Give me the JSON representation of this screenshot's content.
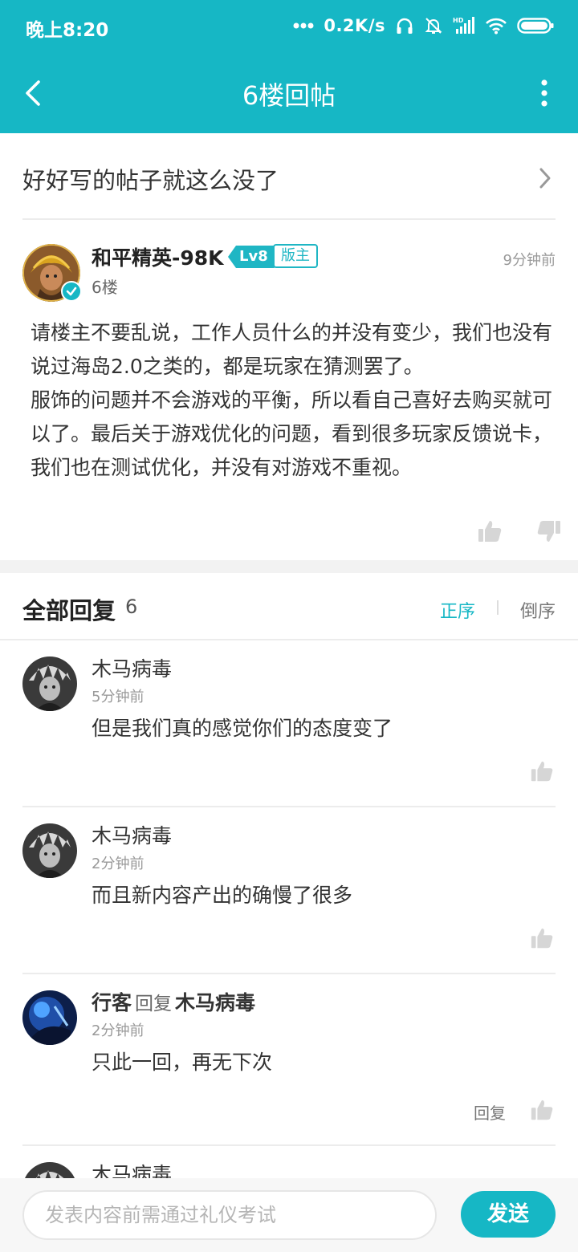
{
  "status_bar": {
    "time": "晚上8:20",
    "network_speed": "0.2K/s"
  },
  "nav": {
    "title": "6楼回帖",
    "icons": [
      "back-arrow-icon",
      "more-vertical-icon"
    ]
  },
  "thread_link": {
    "title": "好好写的帖子就这么没了"
  },
  "floor_post": {
    "author": "和平精英-98K",
    "level": "Lv8",
    "role_badge": "版主",
    "time": "9分钟前",
    "floor": "6楼",
    "content": "请楼主不要乱说，工作人员什么的并没有变少，我们也没有说过海岛2.0之类的，都是玩家在猜测罢了。\n服饰的问题并不会游戏的平衡，所以看自己喜好去购买就可以了。最后关于游戏优化的问题，看到很多玩家反馈说卡，我们也在测试优化，并没有对游戏不重视。"
  },
  "replies_header": {
    "title": "全部回复",
    "count": "6",
    "sort_asc": "正序",
    "sort_desc": "倒序"
  },
  "replies": [
    {
      "user": "木马病毒",
      "time": "5分钟前",
      "text": "但是我们真的感觉你们的态度变了"
    },
    {
      "user": "木马病毒",
      "time": "2分钟前",
      "text": "而且新内容产出的确慢了很多"
    },
    {
      "user": "行客",
      "reply_word": "回复",
      "reply_to": "木马病毒",
      "time": "2分钟前",
      "text": "只此一回，再无下次",
      "reply_action": "回复"
    },
    {
      "user": "木马病毒"
    }
  ],
  "composer": {
    "placeholder": "发表内容前需通过礼仪考试",
    "send_label": "发送"
  },
  "colors": {
    "accent": "#16b7c5",
    "divider": "#ececec"
  }
}
